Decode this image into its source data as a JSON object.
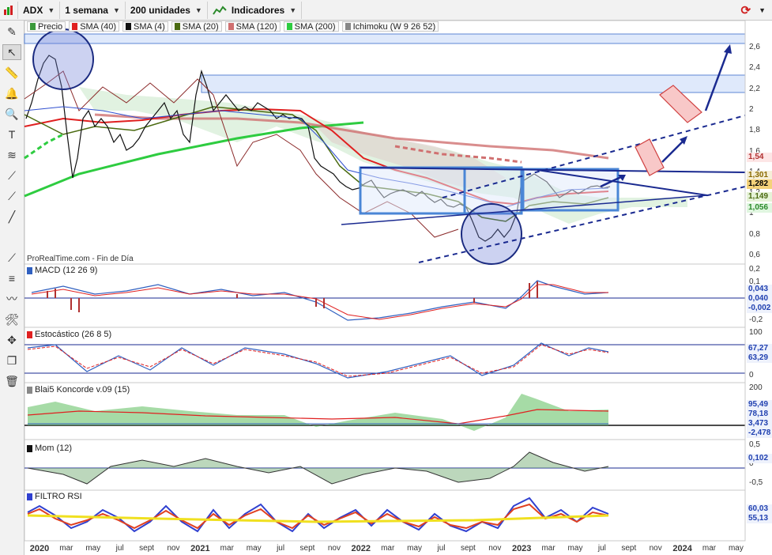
{
  "toolbar": {
    "ticker": "ADX",
    "period": "1 semana",
    "units": "200 unidades",
    "indicators": "Indicadores"
  },
  "legend": [
    {
      "label": "Precio",
      "color": "#3a9a3a"
    },
    {
      "label": "SMA (40)",
      "color": "#e02020"
    },
    {
      "label": "SMA (4)",
      "color": "#111111"
    },
    {
      "label": "SMA (20)",
      "color": "#4a6a10"
    },
    {
      "label": "SMA (120)",
      "color": "#d07070"
    },
    {
      "label": "SMA (200)",
      "color": "#2ecc40"
    },
    {
      "label": "Ichimoku (W 9 26 52)",
      "color": "#888888"
    }
  ],
  "watermark": "ProRealTime.com - Fin de Día",
  "price_axis": [
    "2,6",
    "2,4",
    "2,2",
    "2",
    "1,8",
    "1,6",
    "1,4",
    "1,2",
    "1",
    "0,8",
    "0,6"
  ],
  "price_tags": [
    {
      "value": "1,54",
      "color": "#b03030",
      "bg": "#fde6e6"
    },
    {
      "value": "1,301",
      "color": "#8a6a00",
      "bg": "#f6efd8"
    },
    {
      "value": "1,282",
      "color": "#000000",
      "bg": "#f4d27a"
    },
    {
      "value": "1,149",
      "color": "#4a6a10",
      "bg": "#e6f3d8"
    },
    {
      "value": "1,056",
      "color": "#2a8a2a",
      "bg": "#e0f6e0"
    }
  ],
  "panels": [
    {
      "title": "MACD (12 26 9)",
      "color": "#3060c0",
      "ticks": [
        "0,2",
        "0,1",
        "0",
        "-0,1",
        "-0,2"
      ],
      "tags": [
        "0,043",
        "0,040",
        "-0,002"
      ]
    },
    {
      "title": "Estocástico (26 8 5)",
      "color": "#e02020",
      "ticks": [
        "100",
        "0"
      ],
      "tags": [
        "67,27",
        "63,29"
      ]
    },
    {
      "title": "Blai5 Koncorde v.09 (15)",
      "color": "#888888",
      "ticks": [
        "200",
        "0"
      ],
      "tags": [
        "95,49",
        "78,18",
        "3,473",
        "-2,478"
      ]
    },
    {
      "title": "Mom (12)",
      "color": "#111111",
      "ticks": [
        "0,5",
        "0",
        "-0,5"
      ],
      "tags": [
        "0,102"
      ]
    },
    {
      "title": "FILTRO RSI",
      "color": "#3040d0",
      "ticks": [],
      "tags": [
        "60,03",
        "55,13"
      ]
    }
  ],
  "x_axis": [
    {
      "label": "2020",
      "year": true
    },
    {
      "label": "mar"
    },
    {
      "label": "may"
    },
    {
      "label": "jul"
    },
    {
      "label": "sept"
    },
    {
      "label": "nov"
    },
    {
      "label": "2021",
      "year": true
    },
    {
      "label": "mar"
    },
    {
      "label": "may"
    },
    {
      "label": "jul"
    },
    {
      "label": "sept"
    },
    {
      "label": "nov"
    },
    {
      "label": "2022",
      "year": true
    },
    {
      "label": "mar"
    },
    {
      "label": "may"
    },
    {
      "label": "jul"
    },
    {
      "label": "sept"
    },
    {
      "label": "nov"
    },
    {
      "label": "2023",
      "year": true
    },
    {
      "label": "mar"
    },
    {
      "label": "may"
    },
    {
      "label": "jul"
    },
    {
      "label": "sept"
    },
    {
      "label": "nov"
    },
    {
      "label": "2024",
      "year": true
    },
    {
      "label": "mar"
    },
    {
      "label": "may"
    }
  ]
}
